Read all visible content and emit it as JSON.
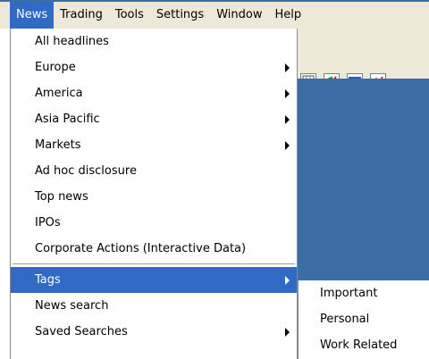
{
  "menubar": {
    "items": [
      "News",
      "Trading",
      "Tools",
      "Settings",
      "Window",
      "Help"
    ],
    "active": "News"
  },
  "news_menu": {
    "group1": [
      {
        "label": "All headlines",
        "submenu": false
      },
      {
        "label": "Europe",
        "submenu": true
      },
      {
        "label": "America",
        "submenu": true
      },
      {
        "label": "Asia Pacific",
        "submenu": true
      },
      {
        "label": "Markets",
        "submenu": true
      },
      {
        "label": "Ad hoc disclosure",
        "submenu": false
      },
      {
        "label": "Top news",
        "submenu": false
      },
      {
        "label": "IPOs",
        "submenu": false
      },
      {
        "label": "Corporate Actions (Interactive Data)",
        "submenu": false
      }
    ],
    "group2": [
      {
        "label": "Tags",
        "submenu": true,
        "highlighted": true
      },
      {
        "label": "News search",
        "submenu": false
      },
      {
        "label": "Saved Searches",
        "submenu": true
      }
    ]
  },
  "tags_submenu": {
    "items": [
      "Important",
      "Personal",
      "Work Related"
    ]
  },
  "toolbar": {
    "icons": [
      "table-icon",
      "chart-icon",
      "window-icon",
      "graph-icon"
    ]
  },
  "colors": {
    "highlight": "#316ac5",
    "workspace": "#3b6ea5",
    "menubar_bg": "#ece9d8"
  }
}
